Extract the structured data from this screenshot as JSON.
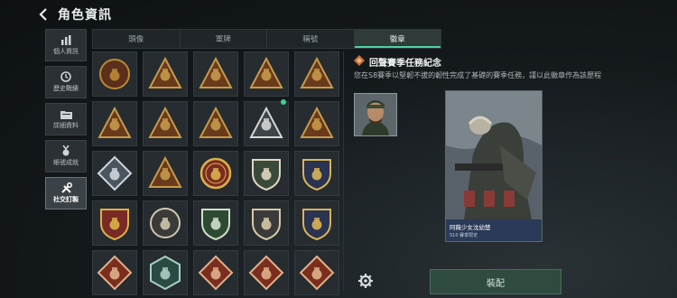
{
  "header": {
    "title": "角色資訊"
  },
  "sidebar": {
    "items": [
      {
        "label": "個人資訊",
        "icon": "bar-chart-icon",
        "active": false
      },
      {
        "label": "歷史戰績",
        "icon": "clock-icon",
        "active": false
      },
      {
        "label": "詳細資料",
        "icon": "folder-icon",
        "active": false
      },
      {
        "label": "帳號成就",
        "icon": "medal-icon",
        "active": false
      },
      {
        "label": "社交訂製",
        "icon": "tools-icon",
        "active": true
      }
    ]
  },
  "tabs": [
    "頭像",
    "軍牌",
    "稱號",
    "徽章"
  ],
  "active_tab": "徽章",
  "badges": [
    {
      "shape": "circle",
      "fg": "#b88a33",
      "bg": "#5b2f1c",
      "icon": "emblem-icon"
    },
    {
      "shape": "triangle",
      "fg": "#c59a4a",
      "bg": "#6a3a1c",
      "icon": "hat-icon"
    },
    {
      "shape": "triangle",
      "fg": "#c59a4a",
      "bg": "#6a3a1c",
      "icon": "number-one-icon"
    },
    {
      "shape": "triangle",
      "fg": "#c59a4a",
      "bg": "#6a3a1c",
      "icon": "jerrycan-icon"
    },
    {
      "shape": "triangle",
      "fg": "#c59a4a",
      "bg": "#6a3a1c",
      "icon": "backpack-icon"
    },
    {
      "shape": "triangle",
      "fg": "#c59a4a",
      "bg": "#6a3a1c",
      "icon": "soldier-icon"
    },
    {
      "shape": "triangle",
      "fg": "#c59a4a",
      "bg": "#6a3a1c",
      "icon": "helmet-icon"
    },
    {
      "shape": "triangle",
      "fg": "#c59a4a",
      "bg": "#6a3a1c",
      "icon": "squad-icon"
    },
    {
      "shape": "triangle",
      "fg": "#d6d6d6",
      "bg": "#3f4448",
      "icon": "dotted-triangle-icon"
    },
    {
      "shape": "triangle",
      "fg": "#c59a4a",
      "bg": "#6a3a1c",
      "icon": "muscle-icon"
    },
    {
      "shape": "diamond",
      "fg": "#d0d6de",
      "bg": "#4a5560",
      "icon": "cube-icon"
    },
    {
      "shape": "triangle",
      "fg": "#c59a4a",
      "bg": "#6a3a1c",
      "icon": "tank-icon"
    },
    {
      "shape": "star-badge",
      "fg": "#d9b24a",
      "bg": "#7a2a24",
      "icon": "star-icon"
    },
    {
      "shape": "shield",
      "fg": "#e0d7c2",
      "bg": "#3a4a3a",
      "icon": "crown-icon"
    },
    {
      "shape": "shield",
      "fg": "#d8b45a",
      "bg": "#2a3350",
      "icon": "winged-sword-icon"
    },
    {
      "shape": "shield",
      "fg": "#d9b24a",
      "bg": "#7a2a24",
      "icon": "eagle-icon"
    },
    {
      "shape": "circle",
      "fg": "#d0c7b0",
      "bg": "#3a3a38",
      "icon": "skull-icon"
    },
    {
      "shape": "shield",
      "fg": "#d0e0c8",
      "bg": "#2f4a34",
      "icon": "crossed-rifles-icon"
    },
    {
      "shape": "shield",
      "fg": "#d8c8a8",
      "bg": "#3a3a3a",
      "icon": "rifle-icon"
    },
    {
      "shape": "shield",
      "fg": "#d8b45a",
      "bg": "#2a3350",
      "icon": "crossed-guns-icon"
    },
    {
      "shape": "diamond",
      "fg": "#e0b08a",
      "bg": "#7a2e1e",
      "icon": "wolf-icon"
    },
    {
      "shape": "hexagon",
      "fg": "#a8d0c0",
      "bg": "#2a4a44",
      "icon": "bird-icon"
    },
    {
      "shape": "diamond",
      "fg": "#e0b08a",
      "bg": "#7a2e1e",
      "icon": "dragon-icon"
    },
    {
      "shape": "diamond",
      "fg": "#e0b08a",
      "bg": "#7a2e1e",
      "icon": "horse-icon"
    },
    {
      "shape": "diamond",
      "fg": "#e0b08a",
      "bg": "#7a2e1e",
      "icon": "flame-icon"
    }
  ],
  "detail": {
    "title": "回聲賽季任務紀念",
    "description": "您在S8賽季以堅韌不拔的韌性完成了基礎的賽季任務，謹以此徽章作為該歷程",
    "preview_name": "阿薇少女沈幼楚",
    "preview_sub": "S10 賽季限定",
    "equip_label": "裝配"
  }
}
